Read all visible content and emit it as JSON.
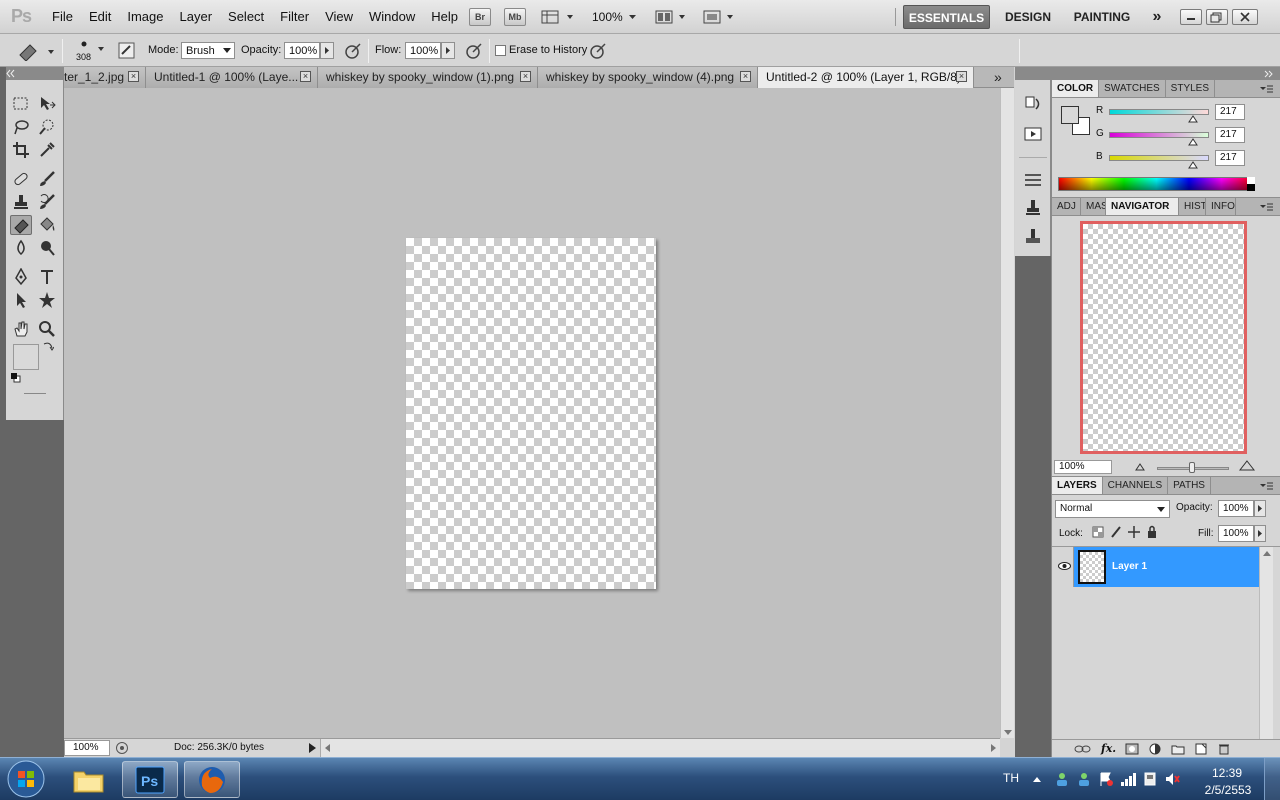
{
  "app": {
    "logo": "Ps"
  },
  "menu": [
    "File",
    "Edit",
    "Image",
    "Layer",
    "Select",
    "Filter",
    "View",
    "Window",
    "Help"
  ],
  "appbar": {
    "bridge": "Br",
    "minibridge": "Mb",
    "zoom": "100%"
  },
  "workspaces": {
    "essentials": "ESSENTIALS",
    "design": "DESIGN",
    "painting": "PAINTING",
    "more": "»"
  },
  "options": {
    "brush_size": "308",
    "mode_label": "Mode:",
    "mode_value": "Brush",
    "opacity_label": "Opacity:",
    "opacity_value": "100%",
    "flow_label": "Flow:",
    "flow_value": "100%",
    "erase_history_label": "Erase to History"
  },
  "tabs": [
    {
      "label": "ter_1_2.jpg"
    },
    {
      "label": "Untitled-1 @ 100% (Laye..."
    },
    {
      "label": "whiskey by spooky_window (1).png"
    },
    {
      "label": "whiskey by spooky_window (4).png"
    },
    {
      "label": "Untitled-2 @ 100% (Layer 1, RGB/8)"
    }
  ],
  "tab_more": "»",
  "status": {
    "zoom": "100%",
    "doc": "Doc: 256.3K/0 bytes"
  },
  "color_panel": {
    "tabs": [
      "COLOR",
      "SWATCHES",
      "STYLES"
    ],
    "r_label": "R",
    "r_value": "217",
    "g_label": "G",
    "g_value": "217",
    "b_label": "B",
    "b_value": "217"
  },
  "nav_panel": {
    "tabs": [
      "ADJ",
      "MAS",
      "NAVIGATOR",
      "HIST",
      "INFO"
    ],
    "zoom": "100%"
  },
  "layers_panel": {
    "tabs": [
      "LAYERS",
      "CHANNELS",
      "PATHS"
    ],
    "blend_mode": "Normal",
    "opacity_label": "Opacity:",
    "opacity_value": "100%",
    "lock_label": "Lock:",
    "fill_label": "Fill:",
    "fill_value": "100%",
    "layers": [
      {
        "name": "Layer 1"
      }
    ]
  },
  "taskbar": {
    "lang": "TH",
    "time": "12:39",
    "date": "2/5/2553"
  },
  "colors": {
    "accent_selection": "#3399ff",
    "canvas_bg": "#c0c0c0",
    "panel_bg": "#d6d6d6"
  }
}
